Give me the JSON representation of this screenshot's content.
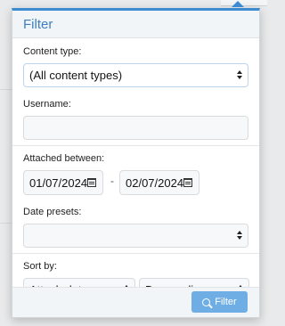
{
  "popup": {
    "title": "Filter"
  },
  "content_type": {
    "label": "Content type:",
    "selected": "(All content types)"
  },
  "username": {
    "label": "Username:",
    "value": ""
  },
  "attached_between": {
    "label": "Attached between:",
    "start": "01/07/2024",
    "separator": "-",
    "end": "02/07/2024"
  },
  "date_presets": {
    "label": "Date presets:",
    "selected": ""
  },
  "sort": {
    "label": "Sort by:",
    "field": "Attach date",
    "direction": "Descending"
  },
  "footer": {
    "filter_button": "Filter",
    "filter_icon": "search-icon"
  },
  "colors": {
    "accent": "#3d8bd2",
    "title": "#3d7fc1",
    "button": "#6faee5"
  },
  "icons": {
    "calendar": "calendar-icon",
    "select": "chevron-up-down-icon"
  }
}
